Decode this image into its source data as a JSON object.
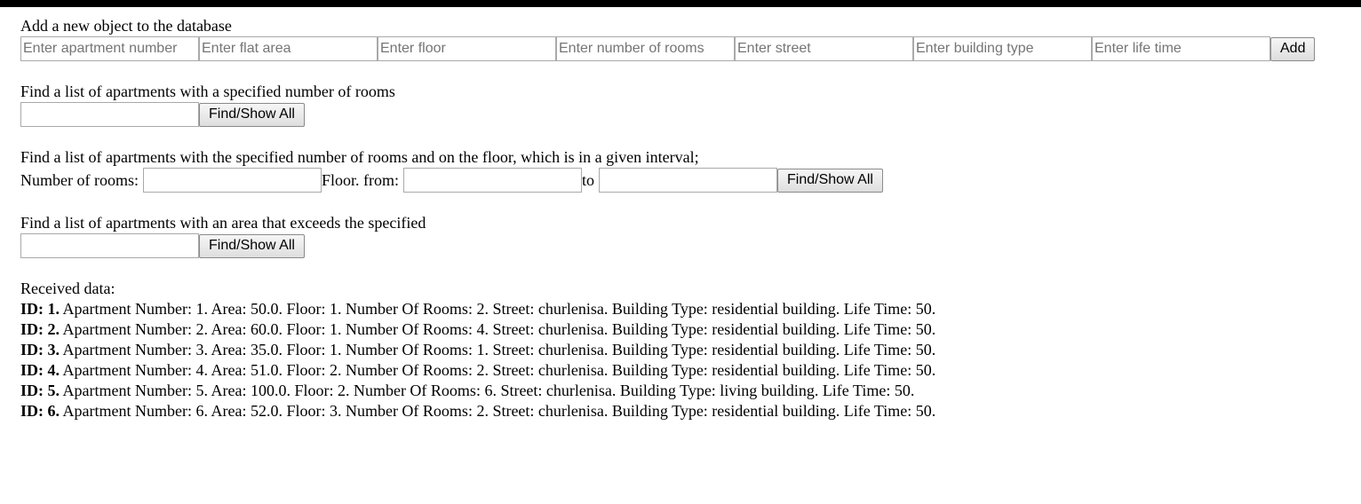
{
  "add_section": {
    "title": "Add a new object to the database",
    "inputs": [
      {
        "placeholder": "Enter apartment number"
      },
      {
        "placeholder": "Enter flat area"
      },
      {
        "placeholder": "Enter floor"
      },
      {
        "placeholder": "Enter number of rooms"
      },
      {
        "placeholder": "Enter street"
      },
      {
        "placeholder": "Enter building type"
      },
      {
        "placeholder": "Enter life time"
      }
    ],
    "button_label": "Add"
  },
  "rooms_section": {
    "title": "Find a list of apartments with a specified number of rooms",
    "input_value": "",
    "button_label": "Find/Show All"
  },
  "interval_section": {
    "title": "Find a list of apartments with the specified number of rooms and on the floor, which is in a given interval;",
    "rooms_label": "Number of rooms:",
    "from_label": "Floor. from:",
    "to_label": "to",
    "button_label": "Find/Show All"
  },
  "area_section": {
    "title": "Find a list of apartments with an area that exceeds the specified",
    "input_value": "",
    "button_label": "Find/Show All"
  },
  "results": {
    "title": "Received data:",
    "rows": [
      {
        "id": "ID: 1.",
        "text": " Apartment Number: 1. Area: 50.0. Floor: 1. Number Of Rooms: 2. Street: churlenisa. Building Type: residential building. Life Time: 50."
      },
      {
        "id": "ID: 2.",
        "text": " Apartment Number: 2. Area: 60.0. Floor: 1. Number Of Rooms: 4. Street: churlenisa. Building Type: residential building. Life Time: 50."
      },
      {
        "id": "ID: 3.",
        "text": " Apartment Number: 3. Area: 35.0. Floor: 1. Number Of Rooms: 1. Street: churlenisa. Building Type: residential building. Life Time: 50."
      },
      {
        "id": "ID: 4.",
        "text": " Apartment Number: 4. Area: 51.0. Floor: 2. Number Of Rooms: 2. Street: churlenisa. Building Type: residential building. Life Time: 50."
      },
      {
        "id": "ID: 5.",
        "text": " Apartment Number: 5. Area: 100.0. Floor: 2. Number Of Rooms: 6. Street: churlenisa. Building Type: living building. Life Time: 50."
      },
      {
        "id": "ID: 6.",
        "text": " Apartment Number: 6. Area: 52.0. Floor: 3. Number Of Rooms: 2. Street: churlenisa. Building Type: residential building. Life Time: 50."
      }
    ]
  }
}
